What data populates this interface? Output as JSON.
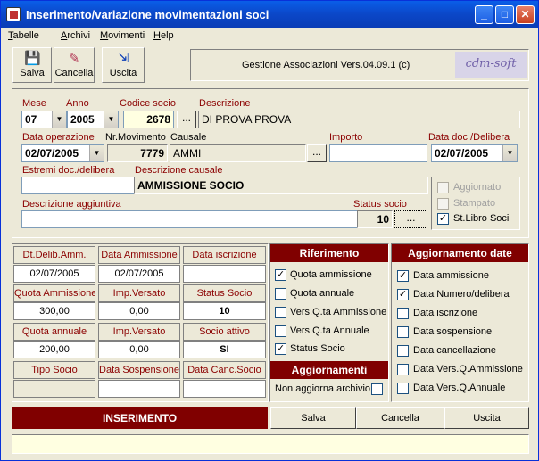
{
  "window": {
    "title": "Inserimento/variazione movimentazioni soci"
  },
  "menu": [
    "Tabelle",
    "Archivi",
    "Movimenti",
    "Help"
  ],
  "toolbar": {
    "save": "Salva",
    "delete": "Cancella",
    "exit": "Uscita"
  },
  "app_info": "Gestione Associazioni Vers.04.09.1 (c)",
  "logo_text": "cdm-soft",
  "form": {
    "mese_label": "Mese",
    "mese": "07",
    "anno_label": "Anno",
    "anno": "2005",
    "codice_label": "Codice socio",
    "codice": "2678",
    "descrizione_label": "Descrizione",
    "descrizione": "DI PROVA PROVA",
    "data_op_label": "Data operazione",
    "data_op": "02/07/2005",
    "nmov_label": "Nr.Movimento",
    "nmov": "7779",
    "causale_label": "Causale",
    "causale": "AMMI",
    "importo_label": "Importo",
    "importo": "",
    "datadoc_label": "Data doc./Delibera",
    "datadoc": "02/07/2005",
    "estremi_label": "Estremi doc./delibera",
    "estremi": "",
    "desc_causale_label": "Descrizione causale",
    "desc_causale": "AMMISSIONE SOCIO",
    "desc_agg_label": "Descrizione aggiuntiva",
    "desc_agg": "",
    "status_label": "Status socio",
    "status": "10",
    "ellipsis": "..."
  },
  "flags": [
    {
      "label": "Aggiornato",
      "checked": false,
      "enabled": false
    },
    {
      "label": "Stampato",
      "checked": false,
      "enabled": false
    },
    {
      "label": "St.Libro Soci",
      "checked": true,
      "enabled": true
    }
  ],
  "grid": {
    "row1_h": [
      "Dt.Delib.Amm.",
      "Data Ammissione",
      "Data iscrizione"
    ],
    "row1_v": [
      "02/07/2005",
      "02/07/2005",
      ""
    ],
    "row2_h": [
      "Quota Ammissione",
      "Imp.Versato",
      "Status Socio"
    ],
    "row2_v": [
      "300,00",
      "0,00",
      "10"
    ],
    "row3_h": [
      "Quota annuale",
      "Imp.Versato",
      "Socio attivo"
    ],
    "row3_v": [
      "200,00",
      "0,00",
      "SI"
    ],
    "row4_h": [
      "Tipo Socio",
      "Data Sospensione",
      "Data Canc.Socio"
    ],
    "row4_v": [
      "",
      "",
      ""
    ]
  },
  "riferimento": {
    "title": "Riferimento",
    "items": [
      {
        "label": "Quota ammissione",
        "checked": true
      },
      {
        "label": "Quota annuale",
        "checked": false
      },
      {
        "label": "Vers.Q.ta Ammissione",
        "checked": false
      },
      {
        "label": "Vers.Q.ta Annuale",
        "checked": false
      },
      {
        "label": "Status Socio",
        "checked": true
      }
    ]
  },
  "aggiornamenti": {
    "title": "Aggiornamenti",
    "label": "Non aggiorna archivio",
    "checked": false
  },
  "date_upd": {
    "title": "Aggiornamento date",
    "items": [
      {
        "label": "Data ammissione",
        "checked": true
      },
      {
        "label": "Data Numero/delibera",
        "checked": true
      },
      {
        "label": "Data iscrizione",
        "checked": false
      },
      {
        "label": "Data sospensione",
        "checked": false
      },
      {
        "label": "Data cancellazione",
        "checked": false
      },
      {
        "label": "Data Vers.Q.Ammissione",
        "checked": false
      },
      {
        "label": "Data Vers.Q.Annuale",
        "checked": false
      }
    ]
  },
  "bottom": {
    "mode": "INSERIMENTO",
    "save": "Salva",
    "delete": "Cancella",
    "exit": "Uscita"
  },
  "status_bar": ""
}
